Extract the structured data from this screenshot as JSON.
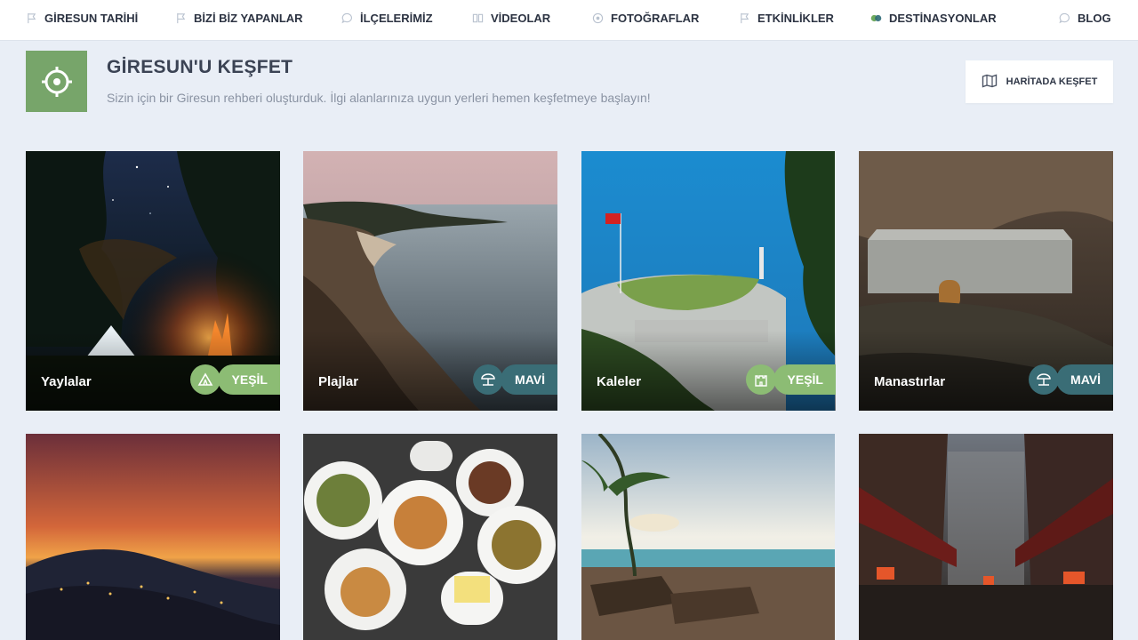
{
  "nav": {
    "items": [
      {
        "label": "GİRESUN TARİHİ",
        "icon": "flag-icon"
      },
      {
        "label": "BİZİ BİZ YAPANLAR",
        "icon": "flag-icon"
      },
      {
        "label": "İLÇELERİMİZ",
        "icon": "chat-icon"
      },
      {
        "label": "VİDEOLAR",
        "icon": "book-icon"
      },
      {
        "label": "FOTOĞRAFLAR",
        "icon": "camera-icon"
      },
      {
        "label": "ETKİNLİKLER",
        "icon": "flag-icon"
      },
      {
        "label": "DESTİNASYONLAR",
        "icon": "circles-icon"
      },
      {
        "label": "BLOG",
        "icon": "chat-icon"
      }
    ]
  },
  "header": {
    "title": "GİRESUN'U KEŞFET",
    "subtitle": "Sizin için bir Giresun rehberi oluşturduk. İlgi alanlarınıza uygun yerleri hemen keşfetmeye başlayın!",
    "map_button": "HARİTADA KEŞFET",
    "icon": "location-target-icon"
  },
  "cards": [
    {
      "title": "Yaylalar",
      "badge": "YEŞİL",
      "badge_icon": "tent-icon"
    },
    {
      "title": "Plajlar",
      "badge": "MAVİ",
      "badge_icon": "beach-umbrella-icon"
    },
    {
      "title": "Kaleler",
      "badge": "YEŞİL",
      "badge_icon": "castle-icon"
    },
    {
      "title": "Manastırlar",
      "badge": "MAVİ",
      "badge_icon": "beach-umbrella-icon"
    },
    {
      "title": ""
    },
    {
      "title": ""
    },
    {
      "title": ""
    },
    {
      "title": ""
    }
  ],
  "colors": {
    "green": "#8cbc74",
    "blue": "#3a6d76",
    "hero_icon_bg": "#77a56a",
    "page_bg": "#e9eef6"
  }
}
